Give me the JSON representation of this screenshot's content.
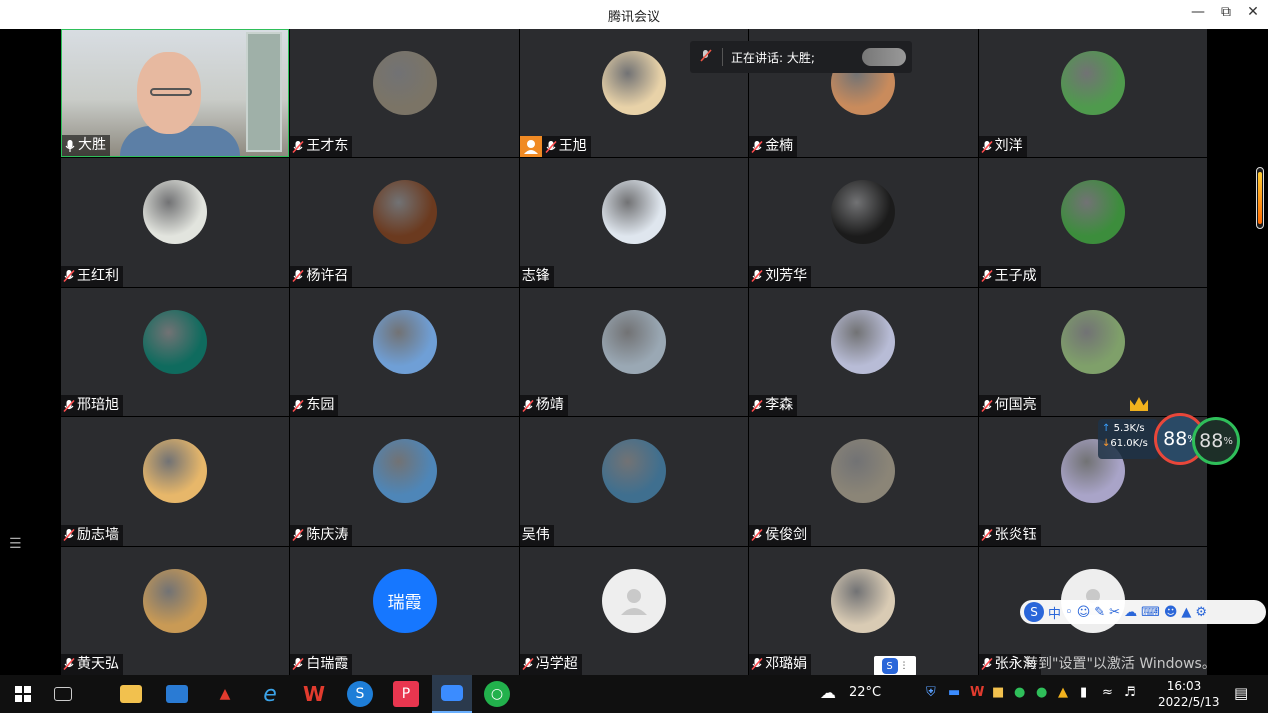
{
  "window": {
    "title": "腾讯会议"
  },
  "speaking_banner": {
    "text": "正在讲话: 大胜;"
  },
  "participants": [
    {
      "name": "大胜",
      "mic": "on",
      "video": true,
      "color": "#cfd4d6"
    },
    {
      "name": "王才东",
      "mic": "muted",
      "color": "#7b7466"
    },
    {
      "name": "王旭",
      "mic": "muted",
      "host": true,
      "color": "#e8d2a8"
    },
    {
      "name": "金楠",
      "mic": "muted",
      "color": "#c98b5c"
    },
    {
      "name": "刘洋",
      "mic": "muted",
      "color": "#4f9a4d"
    },
    {
      "name": "王红利",
      "mic": "muted",
      "color": "#e2e4de"
    },
    {
      "name": "杨许召",
      "mic": "muted",
      "color": "#6b3a1f"
    },
    {
      "name": "志锋",
      "mic": "none",
      "color": "#dfe6ee"
    },
    {
      "name": "刘芳华",
      "mic": "muted",
      "color": "#1b1b1b"
    },
    {
      "name": "王子成",
      "mic": "muted",
      "color": "#3c8d3c"
    },
    {
      "name": "邢琣旭",
      "mic": "muted",
      "color": "#0f6b5e"
    },
    {
      "name": "东园",
      "mic": "muted",
      "color": "#6f9fd6"
    },
    {
      "name": "杨靖",
      "mic": "muted",
      "color": "#9aa8b4"
    },
    {
      "name": "李森",
      "mic": "muted",
      "color": "#b8bcd6"
    },
    {
      "name": "何国亮",
      "mic": "muted",
      "color": "#7fa06a"
    },
    {
      "name": "励志墙",
      "mic": "muted",
      "color": "#e7b76a"
    },
    {
      "name": "陈庆涛",
      "mic": "muted",
      "color": "#4e86b8"
    },
    {
      "name": "吴伟",
      "mic": "none",
      "color": "#3f6f8f"
    },
    {
      "name": "侯俊剑",
      "mic": "muted",
      "color": "#8b8577"
    },
    {
      "name": "张炎钰",
      "mic": "muted",
      "color": "#a9a4c8"
    },
    {
      "name": "黄天弘",
      "mic": "muted",
      "color": "#c99a55"
    },
    {
      "name": "白瑞霞",
      "mic": "muted",
      "initials": "瑞霞",
      "color": "#1677ff"
    },
    {
      "name": "冯学超",
      "mic": "muted",
      "placeholder": true,
      "color": "#eeeeee"
    },
    {
      "name": "邓璐娟",
      "mic": "muted",
      "color": "#d9cbb4"
    },
    {
      "name": "张永海",
      "mic": "muted",
      "placeholder": true,
      "color": "#eeeeee"
    }
  ],
  "net_widget": {
    "upload": "5.3K/s",
    "download": "61.0K/s",
    "percent_a": "88",
    "percent_b": "88",
    "percent_sign": "%"
  },
  "watermark": {
    "line1": "激活 Windows",
    "line2": "转到\"设置\"以激活 Windows。"
  },
  "ime_bar": {
    "mode": "中"
  },
  "taskbar": {
    "weather": "22°C",
    "time": "16:03",
    "date": "2022/5/13"
  },
  "colors": {
    "active_border": "#2fbf5a",
    "tile_bg": "#2b2c2f",
    "accent": "#1677ff",
    "host_badge": "#f08a24"
  }
}
